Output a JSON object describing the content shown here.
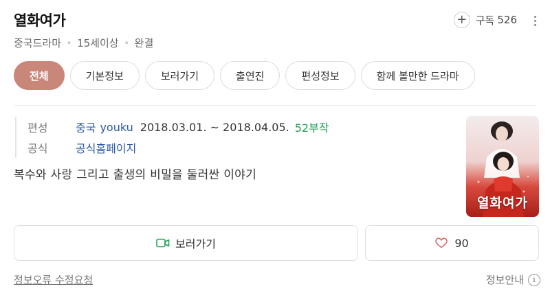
{
  "header": {
    "title": "열화여가",
    "meta": [
      "중국드라마",
      "15세이상",
      "완결"
    ],
    "subscribe_label": "구독",
    "subscribe_count": "526"
  },
  "tabs": [
    {
      "label": "전체",
      "active": true
    },
    {
      "label": "기본정보",
      "active": false
    },
    {
      "label": "보러가기",
      "active": false
    },
    {
      "label": "출연진",
      "active": false
    },
    {
      "label": "편성정보",
      "active": false
    },
    {
      "label": "함께 볼만한 드라마",
      "active": false
    }
  ],
  "info": {
    "broadcast_label": "편성",
    "broadcast_country": "중국",
    "broadcast_channel": "youku",
    "broadcast_period": "2018.03.01. ~ 2018.04.05.",
    "episodes": "52부작",
    "official_label": "공식",
    "official_link": "공식홈페이지"
  },
  "synopsis": "복수와 사랑 그리고 출생의 비밀을 둘러싼 이야기",
  "poster": {
    "title_text": "열화여가"
  },
  "actions": {
    "watch_label": "보러가기",
    "like_count": "90"
  },
  "footer": {
    "report_label": "정보오류 수정요청",
    "guide_label": "정보안내"
  },
  "colors": {
    "accent": "#c9877a",
    "link": "#2c5aa0",
    "episodes": "#1fa05a",
    "watch_icon": "#2aa05a",
    "heart": "#e06a6a"
  }
}
